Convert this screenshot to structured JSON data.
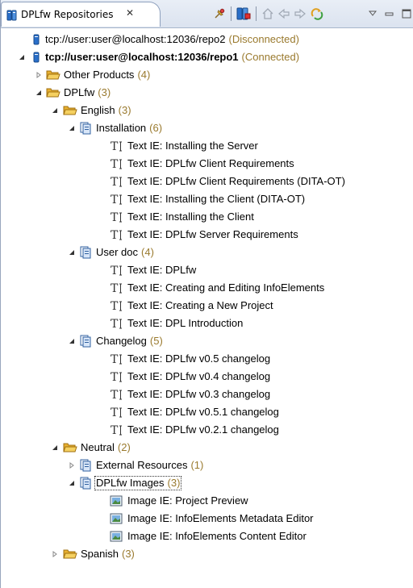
{
  "tab": {
    "title": "DPLfw Repositories",
    "close": "✕"
  },
  "toolbar": {
    "buttons": [
      "pin-icon",
      "collapse-all-icon",
      "home-icon",
      "back-icon",
      "forward-icon",
      "refresh-icon",
      "view-menu-icon",
      "minimize-icon",
      "maximize-icon"
    ]
  },
  "tree": {
    "repo2": {
      "label": "tcp://user:user@localhost:12036/repo2",
      "status": "(Disconnected)"
    },
    "repo1": {
      "label": "tcp://user:user@localhost:12036/repo1",
      "status": "(Connected)"
    },
    "other_products": {
      "label": "Other Products",
      "count": "(4)"
    },
    "dplfw": {
      "label": "DPLfw",
      "count": "(3)"
    },
    "english": {
      "label": "English",
      "count": "(3)"
    },
    "installation": {
      "label": "Installation",
      "count": "(6)"
    },
    "installation_items": [
      "Text IE: Installing the Server",
      "Text IE: DPLfw Client Requirements",
      "Text IE: DPLfw Client Requirements (DITA-OT)",
      "Text IE: Installing the Client (DITA-OT)",
      "Text IE: Installing the Client",
      "Text IE: DPLfw Server Requirements"
    ],
    "user_doc": {
      "label": "User doc",
      "count": "(4)"
    },
    "user_doc_items": [
      "Text IE: DPLfw",
      "Text IE: Creating and Editing InfoElements",
      "Text IE: Creating a New Project",
      "Text IE: DPL Introduction"
    ],
    "changelog": {
      "label": "Changelog",
      "count": "(5)"
    },
    "changelog_items": [
      "Text IE: DPLfw v0.5 changelog",
      "Text IE: DPLfw v0.4 changelog",
      "Text IE: DPLfw v0.3 changelog",
      "Text IE: DPLfw v0.5.1 changelog",
      "Text IE: DPLfw v0.2.1 changelog"
    ],
    "neutral": {
      "label": "Neutral",
      "count": "(2)"
    },
    "external_resources": {
      "label": "External Resources",
      "count": "(1)"
    },
    "dplfw_images": {
      "label": "DPLfw Images",
      "count": "(3)"
    },
    "image_items": [
      "Image IE: Project Preview",
      "Image IE: InfoElements Metadata Editor",
      "Image IE: InfoElements Content Editor"
    ],
    "spanish": {
      "label": "Spanish",
      "count": "(3)"
    }
  }
}
